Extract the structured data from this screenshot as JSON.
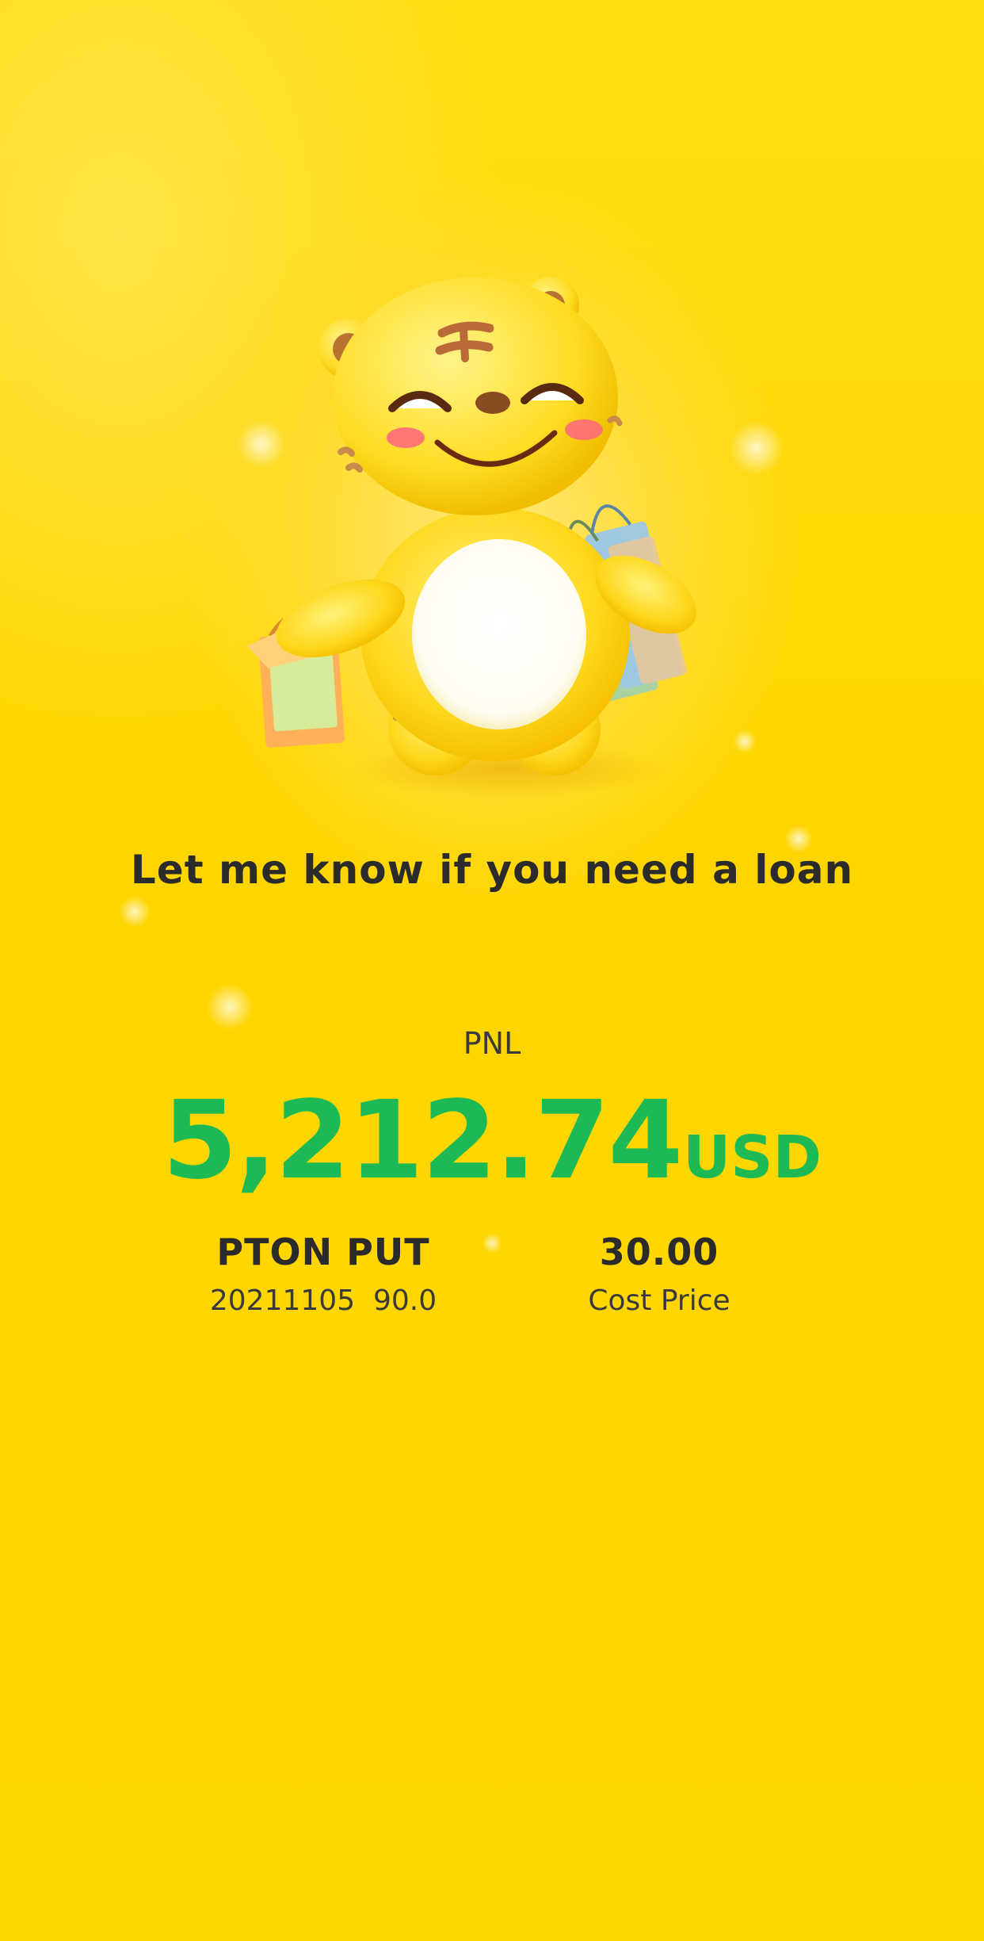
{
  "caption": "Let me know if you need a loan",
  "pnl": {
    "label": "PNL",
    "amount": "5,212.74",
    "unit": "USD",
    "color": "#1db954"
  },
  "position": {
    "symbol": "PTON PUT",
    "detail": "20211105  90.0"
  },
  "cost": {
    "value": "30.00",
    "label": "Cost Price"
  },
  "mascot": {
    "icon": "tiger-mascot-shopping-bags-icon"
  },
  "colors": {
    "background": "#ffd800",
    "text": "#2b2b2b",
    "profit": "#1db954"
  }
}
